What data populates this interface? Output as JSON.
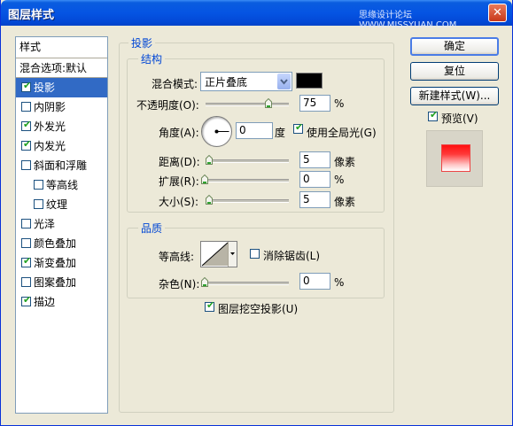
{
  "window": {
    "title": "图层样式",
    "watermark": "思缘设计论坛 WWW.MISSYUAN.COM",
    "close_glyph": "✕"
  },
  "sidebar": {
    "header": "样式",
    "blend_options": "混合选项:默认",
    "items": [
      {
        "label": "投影",
        "checked": true,
        "selected": true
      },
      {
        "label": "内阴影",
        "checked": false
      },
      {
        "label": "外发光",
        "checked": true
      },
      {
        "label": "内发光",
        "checked": true
      },
      {
        "label": "斜面和浮雕",
        "checked": false
      },
      {
        "label": "等高线",
        "checked": false
      },
      {
        "label": "纹理",
        "checked": false
      },
      {
        "label": "光泽",
        "checked": false
      },
      {
        "label": "颜色叠加",
        "checked": false
      },
      {
        "label": "渐变叠加",
        "checked": true
      },
      {
        "label": "图案叠加",
        "checked": false
      },
      {
        "label": "描边",
        "checked": true
      }
    ]
  },
  "drop_shadow": {
    "section_title": "投影",
    "structure": {
      "title": "结构",
      "blend_mode_label": "混合模式:",
      "blend_mode_value": "正片叠底",
      "shadow_color": "#000000",
      "opacity_label": "不透明度(O):",
      "opacity_value": "75",
      "opacity_fraction": 0.75,
      "percent": "%",
      "angle_label": "角度(A):",
      "angle_value": "0",
      "angle_unit": "度",
      "global_light_label": "使用全局光(G)",
      "global_light_checked": true,
      "distance_label": "距离(D):",
      "distance_value": "5",
      "spread_label": "扩展(R):",
      "spread_value": "0",
      "size_label": "大小(S):",
      "size_value": "5",
      "pixel_unit": "像素"
    },
    "quality": {
      "title": "品质",
      "contour_label": "等高线:",
      "anti_alias_label": "消除锯齿(L)",
      "anti_alias_checked": false,
      "noise_label": "杂色(N):",
      "noise_value": "0",
      "percent": "%"
    },
    "knockout_label": "图层挖空投影(U)",
    "knockout_checked": true
  },
  "buttons": {
    "ok": "确定",
    "reset": "复位",
    "new_style": "新建样式(W)...",
    "preview_label": "预览(V)",
    "preview_checked": true
  },
  "colors": {
    "title_bar": "#0554e3",
    "selection": "#316ac5",
    "group_title": "#0046d5",
    "check": "#21a121"
  }
}
